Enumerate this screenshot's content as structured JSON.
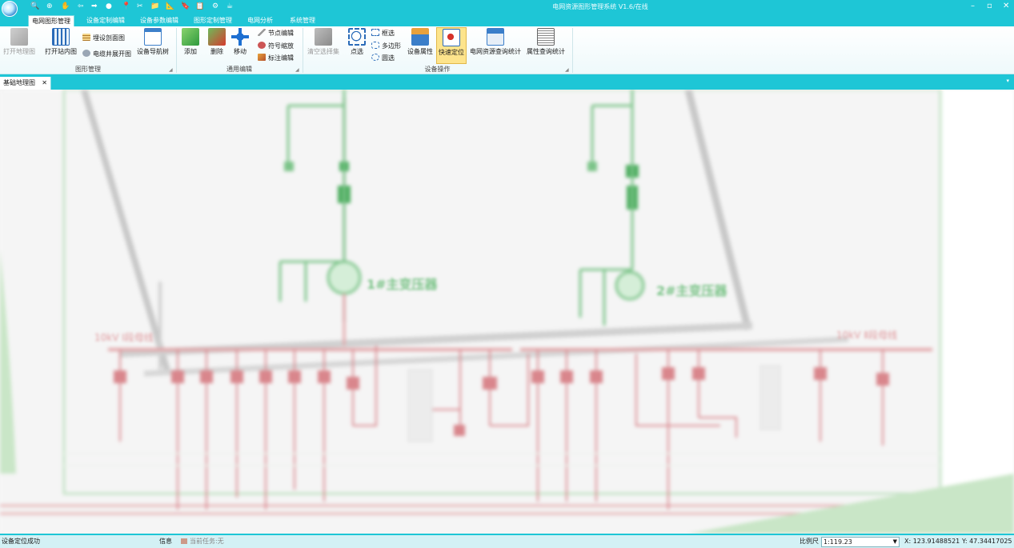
{
  "window": {
    "title": "电网资源图形管理系统 V1.6/在线"
  },
  "quick_access": [
    "🔍",
    "⊕",
    "✋",
    "⇦",
    "➡",
    "●",
    "📍",
    "✂",
    "📁",
    "📐",
    "🔖",
    "📋",
    "⚙",
    "☕"
  ],
  "window_controls": {
    "min": "–",
    "max": "▫",
    "close": "✕"
  },
  "tabs": [
    {
      "label": "电网图形管理",
      "active": true
    },
    {
      "label": "设备定制编辑",
      "active": false
    },
    {
      "label": "设备参数编辑",
      "active": false
    },
    {
      "label": "图形定制管理",
      "active": false
    },
    {
      "label": "电网分析",
      "active": false
    },
    {
      "label": "系统管理",
      "active": false
    }
  ],
  "ribbon": {
    "group1": {
      "title": "图形管理",
      "open_map": "打开地理图",
      "open_station": "打开站内图",
      "burial_section": "埋设剖面图",
      "cable_well": "电缆井展开图",
      "device_tree": "设备导航树"
    },
    "group2": {
      "title": "通用编辑",
      "add": "添加",
      "delete": "删除",
      "move": "移动",
      "node_edit": "节点编辑",
      "symbol_scale": "符号缩放",
      "label_edit": "标注编辑"
    },
    "group3": {
      "title": "设备操作",
      "clear_select": "清空选择集",
      "point_select": "点选",
      "box_select": "框选",
      "polygon": "多边形",
      "circle_select": "圆选",
      "device_attr": "设备属性",
      "quick_locate": "快速定位",
      "resource_query": "电网资源查询统计",
      "attr_query": "属性查询统计"
    }
  },
  "document_tab": {
    "label": "基础地理图",
    "close": "✕"
  },
  "diagram": {
    "transformer1": "1#主变压器",
    "transformer2": "2#主变压器",
    "bus1": "10kV Ⅰ段母线",
    "bus2": "10kV Ⅱ段母线"
  },
  "status": {
    "message": "设备定位成功",
    "info": "信息",
    "task": "当前任务:无",
    "scale_label": "比例尺",
    "scale_value": "1:119.23",
    "x": "X: 123.91488521",
    "y": "Y: 47.34417025"
  },
  "colors": {
    "accent": "#1ec6d6",
    "bus_red": "#d9868c",
    "line_green": "#7cc489",
    "gray_band": "#c8c8c8"
  }
}
